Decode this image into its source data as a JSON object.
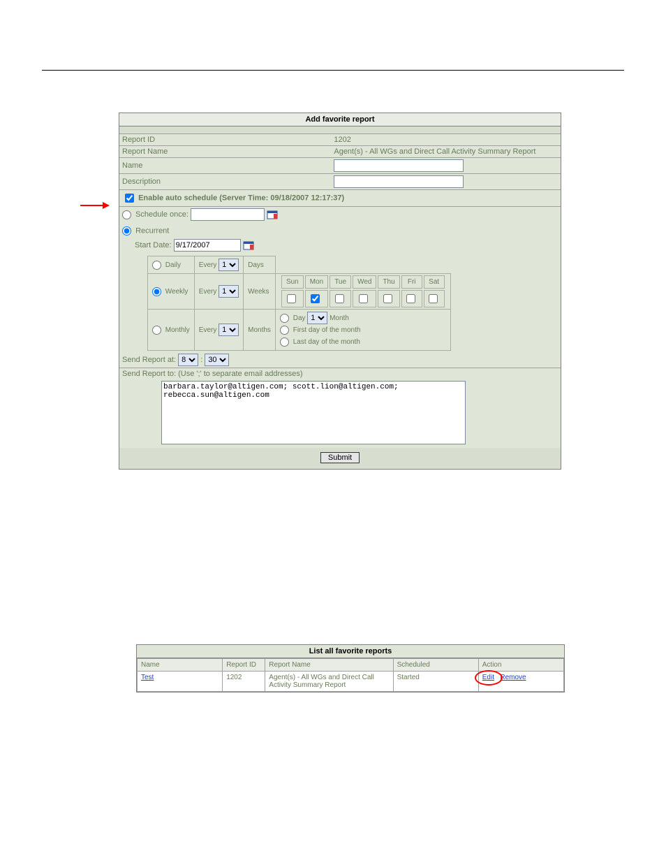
{
  "addPanel": {
    "title": "Add favorite report",
    "reportIdLabel": "Report ID",
    "reportIdValue": "1202",
    "reportNameLabel": "Report Name",
    "reportNameValue": "Agent(s) - All WGs and Direct Call Activity Summary Report",
    "nameLabel": "Name",
    "nameValue": "",
    "descLabel": "Description",
    "descValue": "",
    "enableLabel": "Enable auto schedule (Server Time: 09/18/2007 12:17:37)",
    "scheduleOnceLabel": "Schedule once:",
    "scheduleOnceValue": "",
    "recurrentLabel": "Recurrent",
    "startDateLabel": "Start Date:",
    "startDateValue": "9/17/2007",
    "dailyLabel": "Daily",
    "weeklyLabel": "Weekly",
    "monthlyLabel": "Monthly",
    "everyLabel": "Every",
    "daysLabel": "Days",
    "weeksLabel": "Weeks",
    "monthsLabel": "Months",
    "dailyEvery": "1",
    "weeklyEvery": "1",
    "monthlyEvery": "1",
    "dowHeaders": [
      "Sun",
      "Mon",
      "Tue",
      "Wed",
      "Thu",
      "Fri",
      "Sat"
    ],
    "monthlyDayLabel": "Day",
    "monthlyDayValue": "1",
    "monthLabel": "Month",
    "firstDayLabel": "First day of the month",
    "lastDayLabel": "Last day of the month",
    "sendReportAtLabel": "Send Report at:",
    "sendHour": "8",
    "sendMinute": "30",
    "colon": ":",
    "sendReportToLabel": "Send Report to: (Use ';' to separate email addresses)",
    "emailValue": "barbara.taylor@altigen.com; scott.lion@altigen.com;\nrebecca.sun@altigen.com",
    "submitLabel": "Submit"
  },
  "listPanel": {
    "title": "List all favorite reports",
    "columns": [
      "Name",
      "Report ID",
      "Report Name",
      "Scheduled",
      "Action"
    ],
    "rows": [
      {
        "name": "Test",
        "reportId": "1202",
        "reportName": "Agent(s) - All WGs and Direct Call Activity Summary Report",
        "scheduled": "Started",
        "editLabel": "Edit",
        "removeLabel": "Remove"
      }
    ]
  }
}
